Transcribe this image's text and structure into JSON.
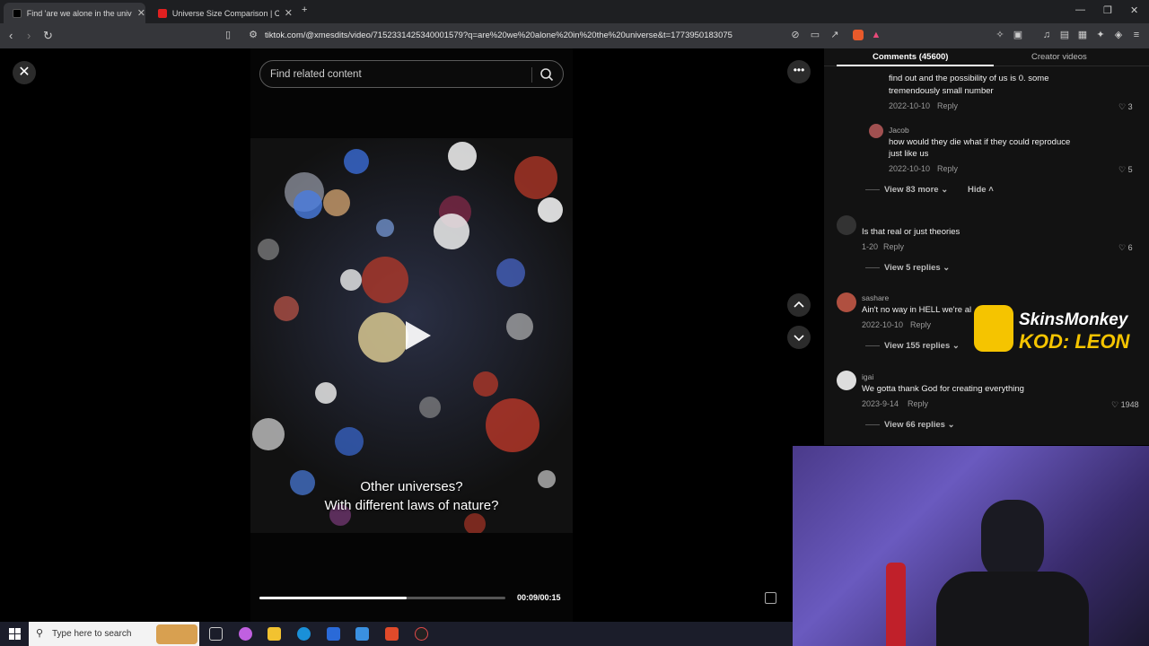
{
  "browser": {
    "tabs": [
      {
        "label": "Find 'are we alone in the univers",
        "active": true
      },
      {
        "label": "Universe Size Comparison | Cosmic E",
        "active": false
      }
    ],
    "url": "tiktok.com/@xmesdits/video/7152331425340001579?q=are%20we%20alone%20in%20the%20universe&t=1773950183075"
  },
  "video_page": {
    "search_placeholder": "Find related content",
    "subtitle_line1": "Other universes?",
    "subtitle_line2": "With different laws of nature?",
    "timecode": "00:09/00:15",
    "progress_fraction": 0.6
  },
  "comments_panel": {
    "tab_comments": "Comments (45600)",
    "tab_creator": "Creator videos",
    "comments": [
      {
        "text_lines": [
          "find out and the possibility of us is 0. some",
          "tremendously small number"
        ],
        "meta": "2022-10-10",
        "reply": "Reply",
        "likes": "3"
      },
      {
        "name": "Jacob",
        "text_lines": [
          "how would they die what if they could reproduce",
          "just like us"
        ],
        "meta": "2022-10-10",
        "reply": "Reply",
        "likes": "5"
      },
      {
        "view_more": "View 83 more",
        "hide": "Hide"
      },
      {
        "name": "",
        "text_lines": [
          "Is that real or just theories"
        ],
        "meta": "1-20",
        "reply": "Reply",
        "likes": "6",
        "view_replies": "View 5 replies"
      },
      {
        "name": "sashare",
        "text_lines": [
          "Ain't no way in HELL we're al"
        ],
        "meta": "2022-10-10",
        "reply": "Reply",
        "view_replies": "View 155 replies"
      },
      {
        "name": "igai",
        "text_lines": [
          "We gotta thank God for creating everything"
        ],
        "meta": "2023-9-14",
        "reply": "Reply",
        "likes": "1948",
        "view_replies": "View 66 replies"
      }
    ]
  },
  "ad": {
    "line1": "SkinsMonkey",
    "line2": "KOD: LEON"
  },
  "taskbar": {
    "search_placeholder": "Type here to search"
  },
  "colors": {
    "tiktok_red": "#fe2c55",
    "ad_yellow": "#f5c400",
    "panel_bg": "#121212"
  }
}
